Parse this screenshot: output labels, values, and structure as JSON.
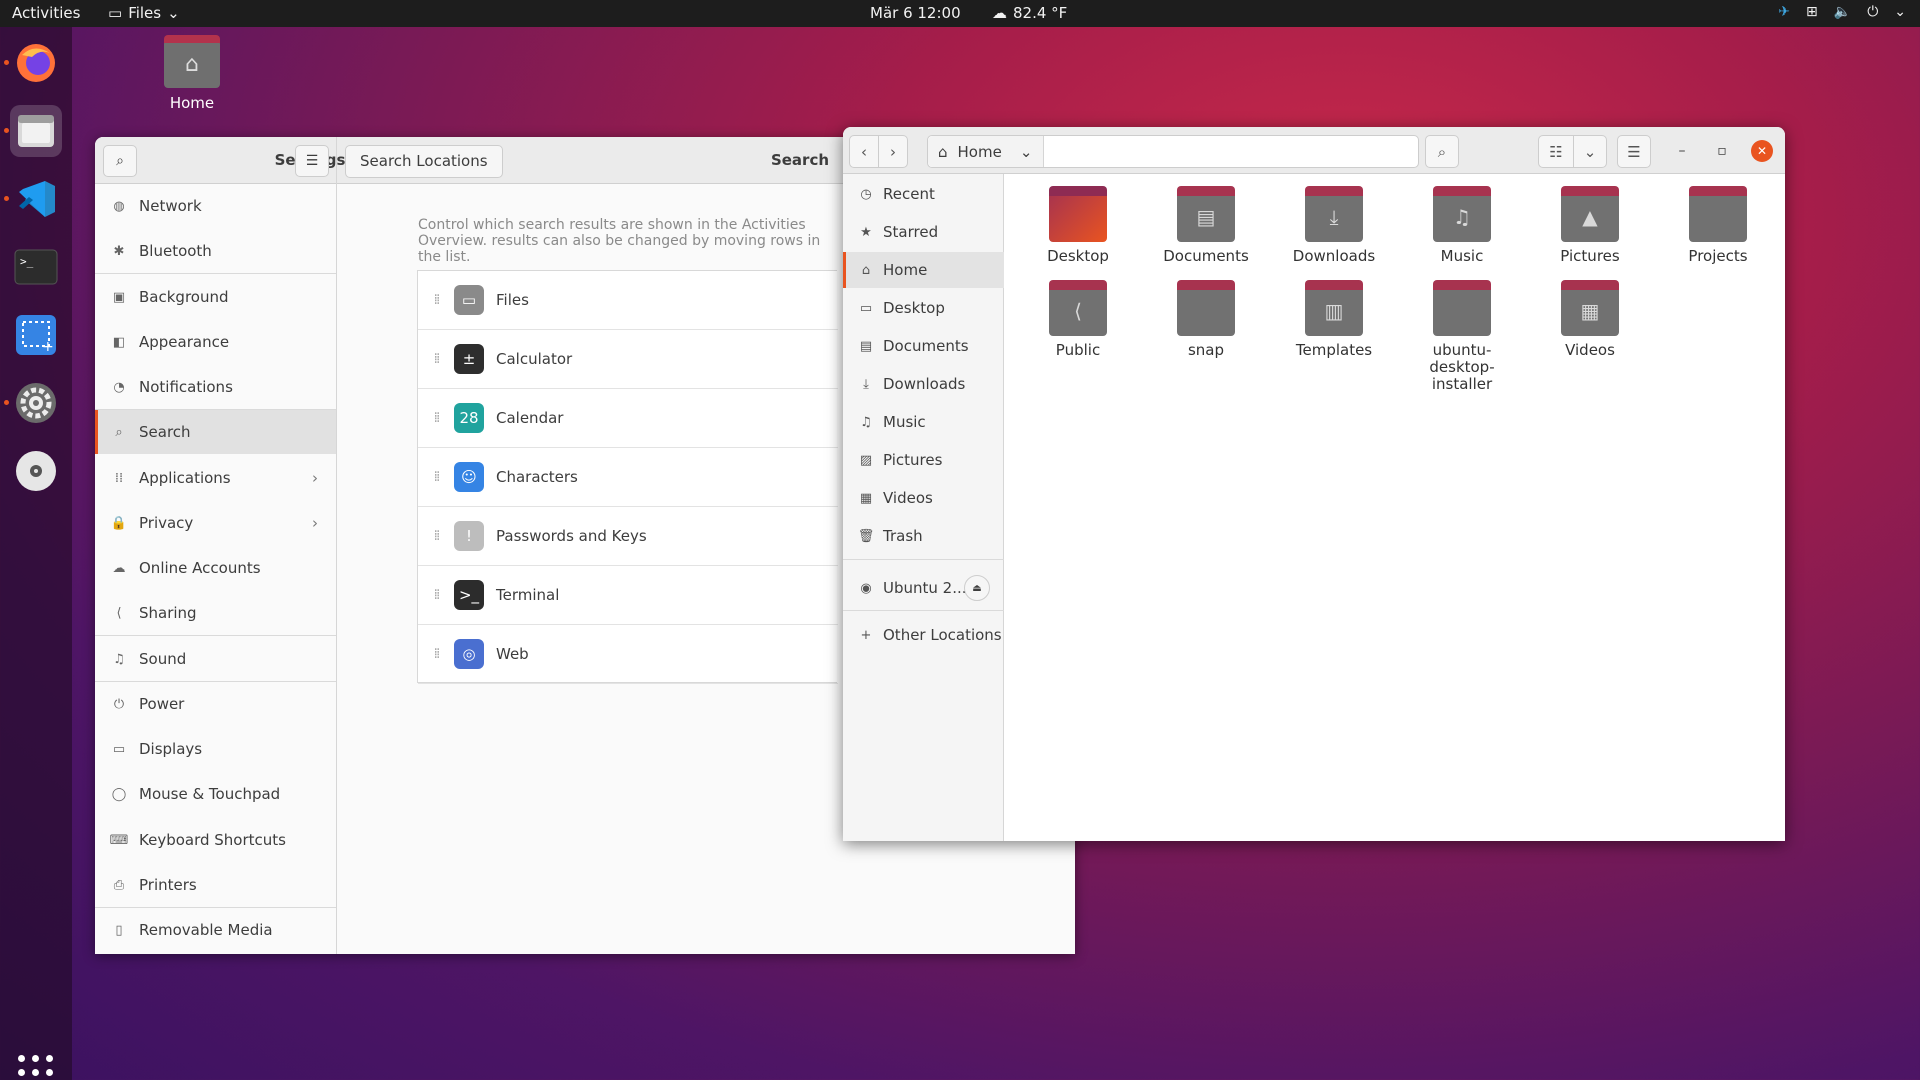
{
  "topbar": {
    "activities": "Activities",
    "app_menu": "Files",
    "clock": "Mär 6  12:00",
    "weather": "82.4 °F"
  },
  "dock": {
    "apps": [
      "firefox-icon",
      "files-icon",
      "vscode-icon",
      "terminal-icon",
      "screenshot-icon",
      "settings-icon",
      "disc-icon"
    ]
  },
  "desktop": {
    "home_label": "Home"
  },
  "settings": {
    "title": "Settings",
    "search_locations": "Search Locations",
    "page_title": "Search",
    "description": "Control which search results are shown in the Activities Overview. results can also be changed by moving rows in the list.",
    "sidebar": [
      {
        "label": "Network",
        "icon": "◍"
      },
      {
        "label": "Bluetooth",
        "icon": "✱"
      },
      {
        "label": "Background",
        "icon": "▣"
      },
      {
        "label": "Appearance",
        "icon": "◧"
      },
      {
        "label": "Notifications",
        "icon": "◔"
      },
      {
        "label": "Search",
        "icon": "⌕"
      },
      {
        "label": "Applications",
        "icon": "⁞⁞"
      },
      {
        "label": "Privacy",
        "icon": "🔒"
      },
      {
        "label": "Online Accounts",
        "icon": "☁"
      },
      {
        "label": "Sharing",
        "icon": "⟨"
      },
      {
        "label": "Sound",
        "icon": "♫"
      },
      {
        "label": "Power",
        "icon": "⏻"
      },
      {
        "label": "Displays",
        "icon": "▭"
      },
      {
        "label": "Mouse & Touchpad",
        "icon": "◯"
      },
      {
        "label": "Keyboard Shortcuts",
        "icon": "⌨"
      },
      {
        "label": "Printers",
        "icon": "⎙"
      },
      {
        "label": "Removable Media",
        "icon": "▯"
      }
    ],
    "providers": [
      {
        "label": "Files",
        "color": "#8a8a8a",
        "glyph": "▭"
      },
      {
        "label": "Calculator",
        "color": "#2e2e2e",
        "glyph": "±"
      },
      {
        "label": "Calendar",
        "color": "#20a39e",
        "glyph": "28"
      },
      {
        "label": "Characters",
        "color": "#3584e4",
        "glyph": "☺"
      },
      {
        "label": "Passwords and Keys",
        "color": "#bdbdbd",
        "glyph": "!"
      },
      {
        "label": "Terminal",
        "color": "#2c2c2c",
        "glyph": ">_"
      },
      {
        "label": "Web",
        "color": "#4a6fd0",
        "glyph": "◎"
      }
    ]
  },
  "files": {
    "path_home": "Home",
    "sidebar": [
      {
        "label": "Recent",
        "icon": "◷"
      },
      {
        "label": "Starred",
        "icon": "★"
      },
      {
        "label": "Home",
        "icon": "⌂"
      },
      {
        "label": "Desktop",
        "icon": "▭"
      },
      {
        "label": "Documents",
        "icon": "▤"
      },
      {
        "label": "Downloads",
        "icon": "⤓"
      },
      {
        "label": "Music",
        "icon": "♫"
      },
      {
        "label": "Pictures",
        "icon": "▨"
      },
      {
        "label": "Videos",
        "icon": "▦"
      },
      {
        "label": "Trash",
        "icon": "🗑"
      }
    ],
    "device": "Ubuntu 2...",
    "other_locations": "Other Locations",
    "folders": [
      {
        "label": "Desktop",
        "glyph": ""
      },
      {
        "label": "Documents",
        "glyph": "▤"
      },
      {
        "label": "Downloads",
        "glyph": "⤓"
      },
      {
        "label": "Music",
        "glyph": "♫"
      },
      {
        "label": "Pictures",
        "glyph": "▲"
      },
      {
        "label": "Projects",
        "glyph": ""
      },
      {
        "label": "Public",
        "glyph": "⟨"
      },
      {
        "label": "snap",
        "glyph": ""
      },
      {
        "label": "Templates",
        "glyph": "▥"
      },
      {
        "label": "ubuntu-desktop-installer",
        "glyph": ""
      },
      {
        "label": "Videos",
        "glyph": "▦"
      }
    ]
  }
}
